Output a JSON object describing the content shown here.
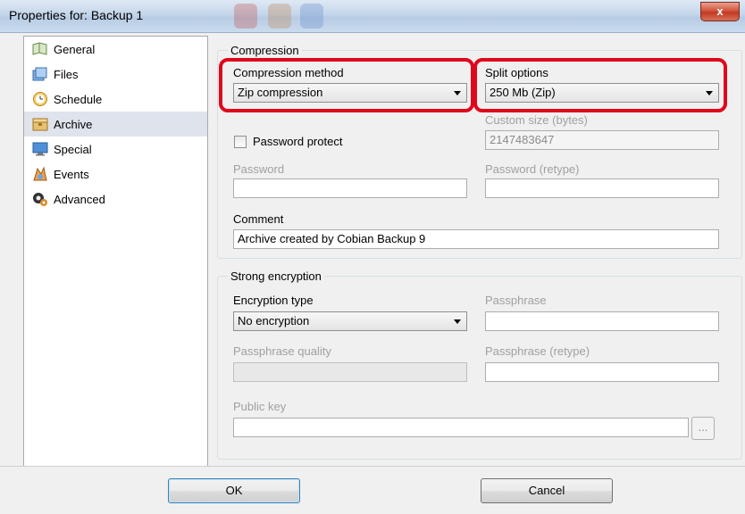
{
  "window": {
    "title": "Properties for: Backup 1",
    "close_label": "x"
  },
  "sidebar": {
    "items": [
      {
        "label": "General",
        "icon": "book-icon",
        "selected": false
      },
      {
        "label": "Files",
        "icon": "files-icon",
        "selected": false
      },
      {
        "label": "Schedule",
        "icon": "clock-icon",
        "selected": false
      },
      {
        "label": "Archive",
        "icon": "archive-icon",
        "selected": true
      },
      {
        "label": "Special",
        "icon": "monitor-icon",
        "selected": false
      },
      {
        "label": "Events",
        "icon": "events-icon",
        "selected": false
      },
      {
        "label": "Advanced",
        "icon": "advanced-icon",
        "selected": false
      }
    ]
  },
  "compression": {
    "group_label": "Compression",
    "method_label": "Compression method",
    "method_value": "Zip compression",
    "split_label": "Split options",
    "split_value": "250 Mb (Zip)",
    "custom_size_label": "Custom size (bytes)",
    "custom_size_value": "2147483647",
    "password_protect_label": "Password protect",
    "password_protect_checked": false,
    "password_label": "Password",
    "password_value": "",
    "password_retype_label": "Password (retype)",
    "password_retype_value": "",
    "comment_label": "Comment",
    "comment_value": "Archive created by Cobian Backup 9"
  },
  "encryption": {
    "group_label": "Strong encryption",
    "type_label": "Encryption type",
    "type_value": "No encryption",
    "passphrase_label": "Passphrase",
    "passphrase_value": "",
    "quality_label": "Passphrase quality",
    "passphrase_retype_label": "Passphrase (retype)",
    "passphrase_retype_value": "",
    "public_key_label": "Public key",
    "public_key_value": "",
    "browse_label": "..."
  },
  "footer": {
    "ok_label": "OK",
    "cancel_label": "Cancel"
  },
  "highlight_color": "#e0061b"
}
